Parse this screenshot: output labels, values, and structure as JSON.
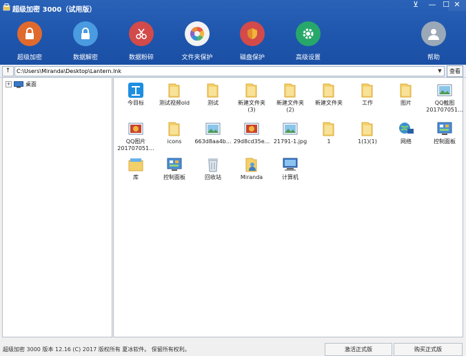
{
  "window": {
    "title": "超级加密 3000（试用版）",
    "controls": [
      "⊻",
      "—",
      "☐",
      "✕"
    ]
  },
  "toolbar": [
    {
      "label": "超级加密",
      "icon": "lock-icon",
      "color": "#e06a2e"
    },
    {
      "label": "数据解密",
      "icon": "unlock-icon",
      "color": "#4a9be0"
    },
    {
      "label": "数据粉碎",
      "icon": "scissors-icon",
      "color": "#d24a4a"
    },
    {
      "label": "文件夹保护",
      "icon": "folder-protect-icon",
      "color": "#f2f2f2"
    },
    {
      "label": "磁盘保护",
      "icon": "shield-icon",
      "color": "#d24a4a"
    },
    {
      "label": "高级设置",
      "icon": "gear-icon",
      "color": "#27a86a"
    },
    {
      "label": "帮助",
      "icon": "user-help-icon",
      "color": "#9aa8b8"
    }
  ],
  "pathbar": {
    "up_label": "↑",
    "path": "C:\\Users\\Miranda\\Desktop\\Lantern.lnk",
    "view_label": "查看"
  },
  "tree": {
    "root_label": "桌面",
    "expand": "+"
  },
  "files": [
    {
      "name": "今目标",
      "icon": "app-icon"
    },
    {
      "name": "测试视频old",
      "icon": "folder-icon"
    },
    {
      "name": "测试",
      "icon": "folder-icon"
    },
    {
      "name": "新建文件夹\n(3)",
      "icon": "folder-icon"
    },
    {
      "name": "新建文件夹\n(2)",
      "icon": "folder-icon"
    },
    {
      "name": "新建文件夹",
      "icon": "folder-icon"
    },
    {
      "name": "工作",
      "icon": "folder-icon"
    },
    {
      "name": "图片",
      "icon": "folder-icon"
    },
    {
      "name": "QQ截图\n201707051...",
      "icon": "image-icon"
    },
    {
      "name": "QQ图片\n201707051...",
      "icon": "photo-icon"
    },
    {
      "name": "icons",
      "icon": "folder-icon"
    },
    {
      "name": "663d8aa4b...",
      "icon": "image-icon"
    },
    {
      "name": "29d8cd35e...",
      "icon": "photo-icon"
    },
    {
      "name": "21791-1.jpg",
      "icon": "image-icon"
    },
    {
      "name": "1",
      "icon": "folder-icon"
    },
    {
      "name": "1(1)(1)",
      "icon": "folder-icon"
    },
    {
      "name": "网络",
      "icon": "network-icon"
    },
    {
      "name": "控制面板",
      "icon": "control-panel-icon"
    },
    {
      "name": "库",
      "icon": "library-icon"
    },
    {
      "name": "控制面板",
      "icon": "control-panel-icon"
    },
    {
      "name": "回收站",
      "icon": "recycle-bin-icon"
    },
    {
      "name": "Miranda",
      "icon": "user-folder-icon"
    },
    {
      "name": "计算机",
      "icon": "computer-icon"
    }
  ],
  "status": {
    "text": "超级加密 3000  版本 12.16  (C)  2017 版权所有 夏冰软件。  保留所有权利。",
    "activate": "激活正式版",
    "buy": "购买正式版"
  }
}
